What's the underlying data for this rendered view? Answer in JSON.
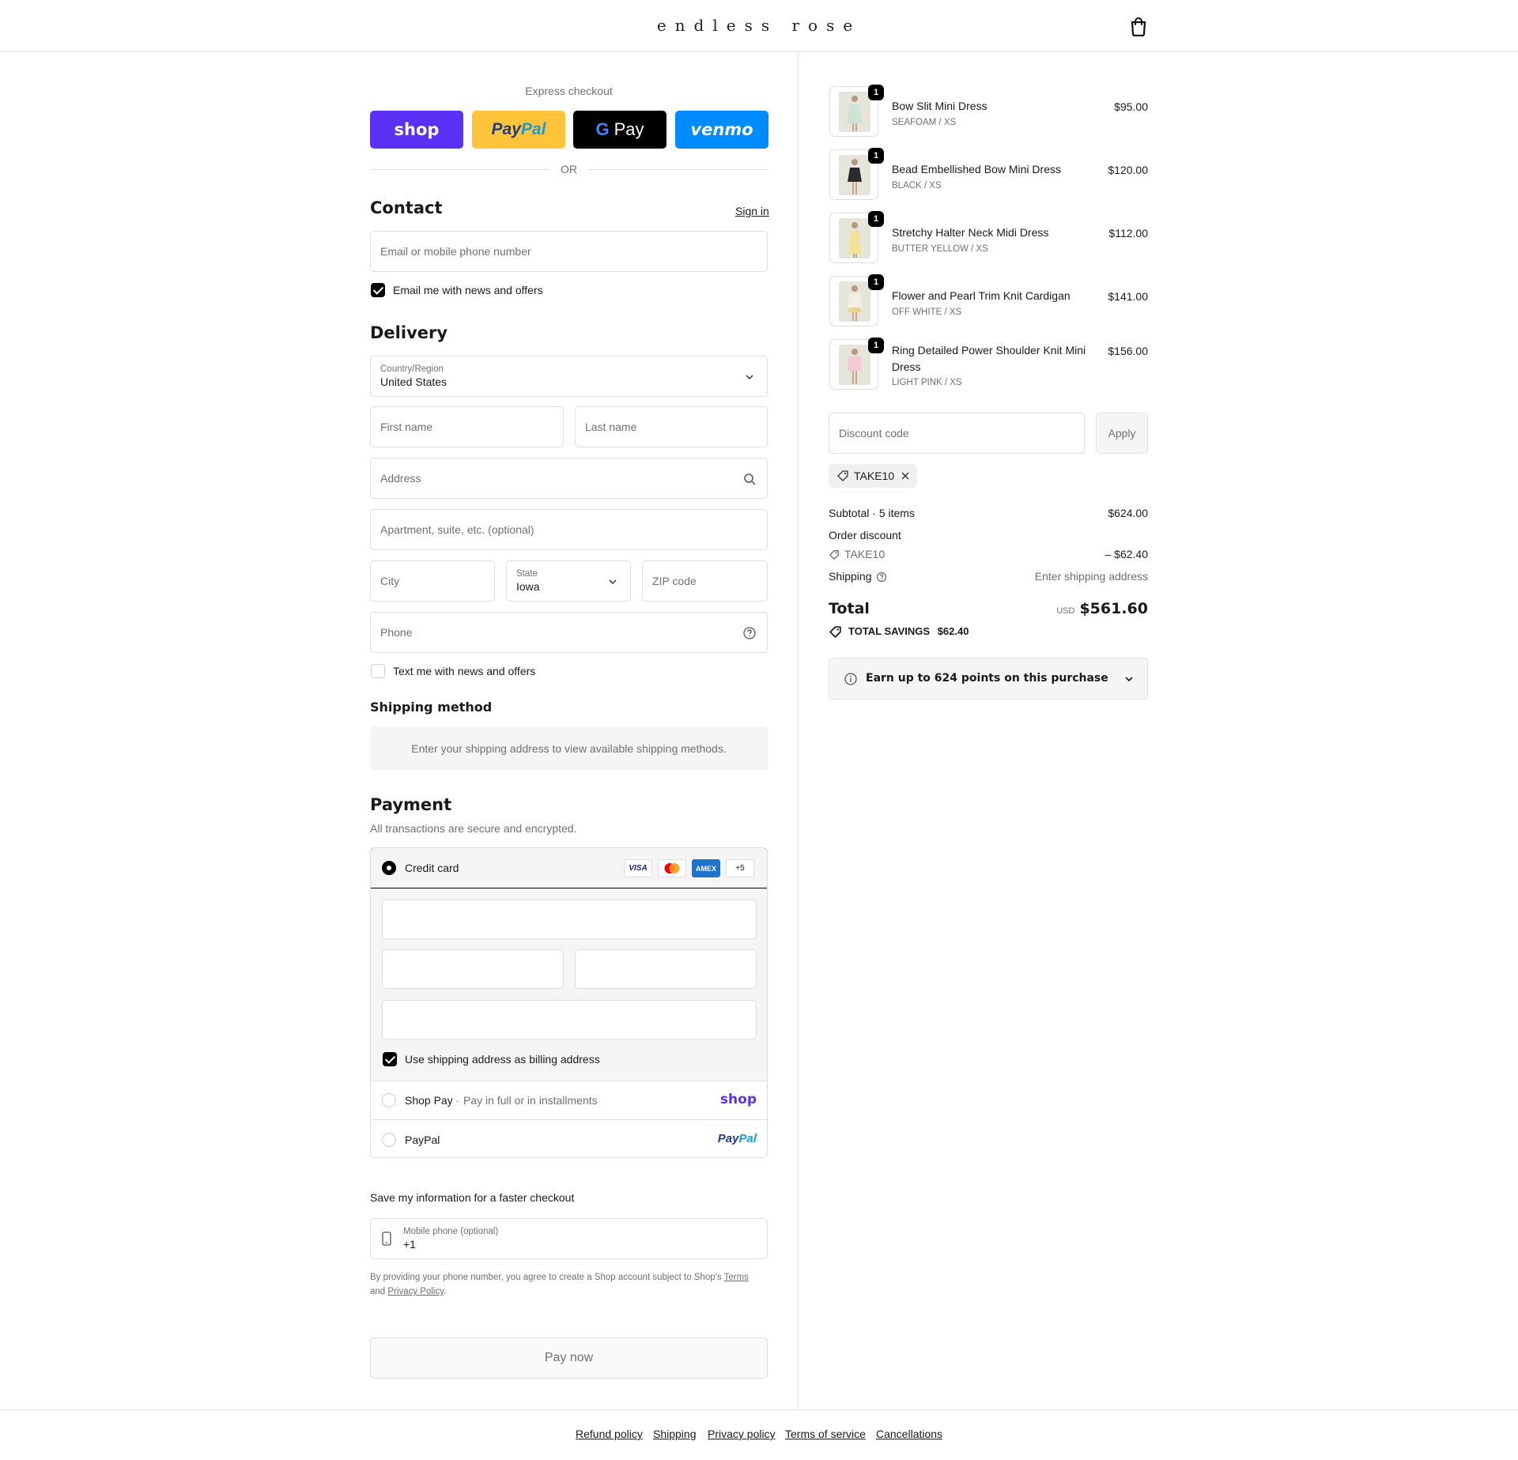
{
  "header": {
    "logo": "endless rose",
    "cart_icon": "shopping-bag-icon"
  },
  "express": {
    "label": "Express checkout",
    "buttons": {
      "shop": "shop",
      "paypal_a": "Pay",
      "paypal_b": "Pal",
      "gpay_g": "G",
      "gpay_text": "Pay",
      "venmo": "venmo"
    },
    "or": "OR"
  },
  "contact": {
    "title": "Contact",
    "sign_in": "Sign in",
    "email_placeholder": "Email or mobile phone number",
    "email_news_label": "Email me with news and offers",
    "email_news_checked": true
  },
  "delivery": {
    "title": "Delivery",
    "country_label": "Country/Region",
    "country_value": "United States",
    "first_name": "First name",
    "last_name": "Last name",
    "address": "Address",
    "apartment": "Apartment, suite, etc. (optional)",
    "city": "City",
    "state_label": "State",
    "state_value": "Iowa",
    "zip": "ZIP code",
    "phone": "Phone",
    "text_news_label": "Text me with news and offers",
    "text_news_checked": false
  },
  "shipping_method": {
    "title": "Shipping method",
    "message": "Enter your shipping address to view available shipping methods."
  },
  "payment": {
    "title": "Payment",
    "subtitle": "All transactions are secure and encrypted.",
    "credit_card_label": "Credit card",
    "card_icons": [
      "VISA",
      "Mastercard",
      "AMEX",
      "+5"
    ],
    "billing_label": "Use shipping address as billing address",
    "billing_checked": true,
    "shop_pay_label": "Shop Pay",
    "shop_pay_sep": "·",
    "shop_pay_desc": "Pay in full or in installments",
    "shop_pay_logo": "shop",
    "paypal_label": "PayPal",
    "paypal_logo_a": "Pay",
    "paypal_logo_b": "Pal"
  },
  "save_info": {
    "title": "Save my information for a faster checkout",
    "mobile_label": "Mobile phone (optional)",
    "mobile_value": "+1",
    "disclaimer_a": "By providing your phone number, you agree to create a Shop account subject to Shop's ",
    "terms": "Terms",
    "disclaimer_b": "and ",
    "privacy": "Privacy Policy",
    "period": "."
  },
  "pay_now": "Pay now",
  "footer": [
    "Refund policy",
    "Shipping",
    "Privacy policy",
    "Terms of service",
    "Cancellations"
  ],
  "cart": {
    "items": [
      {
        "name": "Bow Slit Mini Dress",
        "variant": "SEAFOAM / XS",
        "price": "$95.00",
        "qty": "1",
        "color": "#cfe3d4"
      },
      {
        "name": "Bead Embellished Bow Mini Dress",
        "variant": "BLACK / XS",
        "price": "$120.00",
        "qty": "1",
        "color": "#2b2b2b"
      },
      {
        "name": "Stretchy Halter Neck Midi Dress",
        "variant": "BUTTER YELLOW / XS",
        "price": "$112.00",
        "qty": "1",
        "color": "#f1e39a"
      },
      {
        "name": "Flower and Pearl Trim Knit Cardigan",
        "variant": "OFF WHITE / XS",
        "price": "$141.00",
        "qty": "1",
        "color": "#f4efe2"
      },
      {
        "name": "Ring Detailed Power Shoulder Knit Mini Dress",
        "variant": "LIGHT PINK / XS",
        "price": "$156.00",
        "qty": "1",
        "color": "#f5c9d3"
      }
    ],
    "discount_placeholder": "Discount code",
    "apply": "Apply",
    "applied_code": "TAKE10",
    "subtotal_label": "Subtotal · 5 items",
    "subtotal": "$624.00",
    "order_discount_label": "Order discount",
    "discount_code": "TAKE10",
    "discount_amount": "– $62.40",
    "shipping_label": "Shipping",
    "shipping_value": "Enter shipping address",
    "total_label": "Total",
    "currency": "USD",
    "total": "$561.60",
    "savings_label": "TOTAL SAVINGS",
    "savings_amount": "$62.40",
    "points_text": "Earn up to 624 points on this purchase"
  }
}
